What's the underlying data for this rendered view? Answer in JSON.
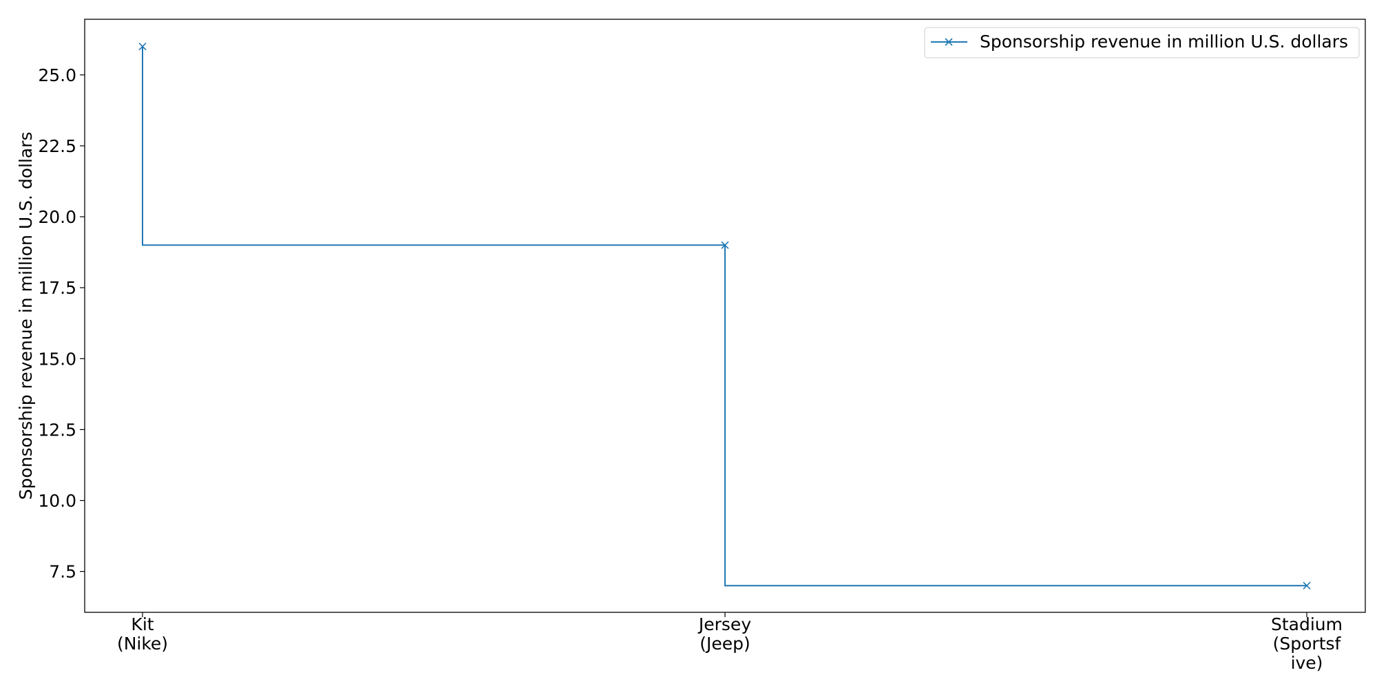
{
  "chart_data": {
    "type": "line",
    "style": "step",
    "title": "",
    "xlabel": "",
    "ylabel": "Sponsorship revenue in million U.S. dollars",
    "categories": [
      [
        "Kit",
        "(Nike)"
      ],
      [
        "Jersey",
        "(Jeep)"
      ],
      [
        "Stadium",
        "(Sportsf",
        "ive)"
      ]
    ],
    "series": [
      {
        "name": "Sponsorship revenue in million U.S. dollars",
        "values": [
          26,
          19,
          7
        ],
        "color": "#1f77b4",
        "marker": "x"
      }
    ],
    "ylim": [
      6.06,
      26.96
    ],
    "yticks": [
      "7.5",
      "10.0",
      "12.5",
      "15.0",
      "17.5",
      "20.0",
      "22.5",
      "25.0"
    ],
    "grid": false,
    "legend_position": "top-right"
  }
}
